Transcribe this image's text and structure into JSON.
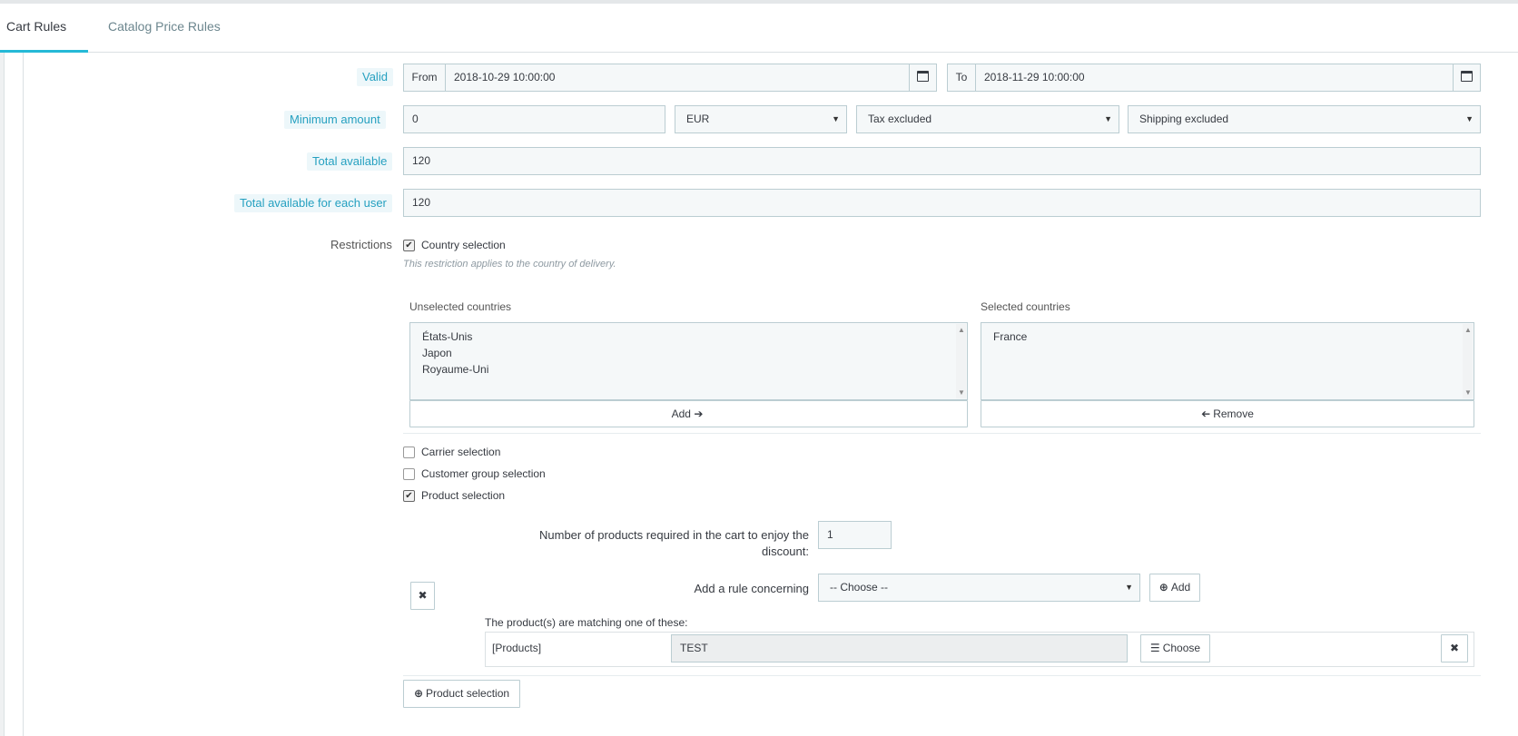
{
  "tabs": [
    {
      "label": "Cart Rules"
    },
    {
      "label": "Catalog Price Rules"
    }
  ],
  "valid": {
    "label": "Valid",
    "from_label": "From",
    "from_value": "2018-10-29 10:00:00",
    "to_label": "To",
    "to_value": "2018-11-29 10:00:00"
  },
  "minimum_amount": {
    "label": "Minimum amount",
    "value": "0",
    "currency": "EUR",
    "tax": "Tax excluded",
    "shipping": "Shipping excluded"
  },
  "total_available": {
    "label": "Total available",
    "value": "120"
  },
  "total_per_user": {
    "label": "Total available for each user",
    "value": "120"
  },
  "restrictions": {
    "label": "Restrictions",
    "country_selection": "Country selection",
    "country_help": "This restriction applies to the country of delivery.",
    "unselected_title": "Unselected countries",
    "unselected": [
      "États-Unis",
      "Japon",
      "Royaume-Uni"
    ],
    "selected_title": "Selected countries",
    "selected": [
      "France"
    ],
    "add_label": "Add",
    "remove_label": "Remove",
    "carrier_selection": "Carrier selection",
    "customer_group_selection": "Customer group selection",
    "product_selection": "Product selection"
  },
  "product_rules": {
    "quantity_label": "Number of products required in the cart to enjoy the discount:",
    "quantity_value": "1",
    "add_rule_label": "Add a rule concerning",
    "rule_choice": "-- Choose --",
    "add_button": "Add",
    "matching_text": "The product(s) are matching one of these:",
    "rule_type": "[Products]",
    "rule_value": "TEST",
    "choose_button": "Choose",
    "product_selection_button": "Product selection"
  },
  "icons": {
    "calendar": "calendar-icon",
    "arrow_right": "arrow-right-icon",
    "arrow_left": "arrow-left-icon",
    "close": "close-icon",
    "plus_circle": "plus-circle-icon",
    "list": "list-icon"
  },
  "colors": {
    "accent": "#25b9d7",
    "hint_bg": "#edf7fa",
    "hint_text": "#25a0c0"
  }
}
